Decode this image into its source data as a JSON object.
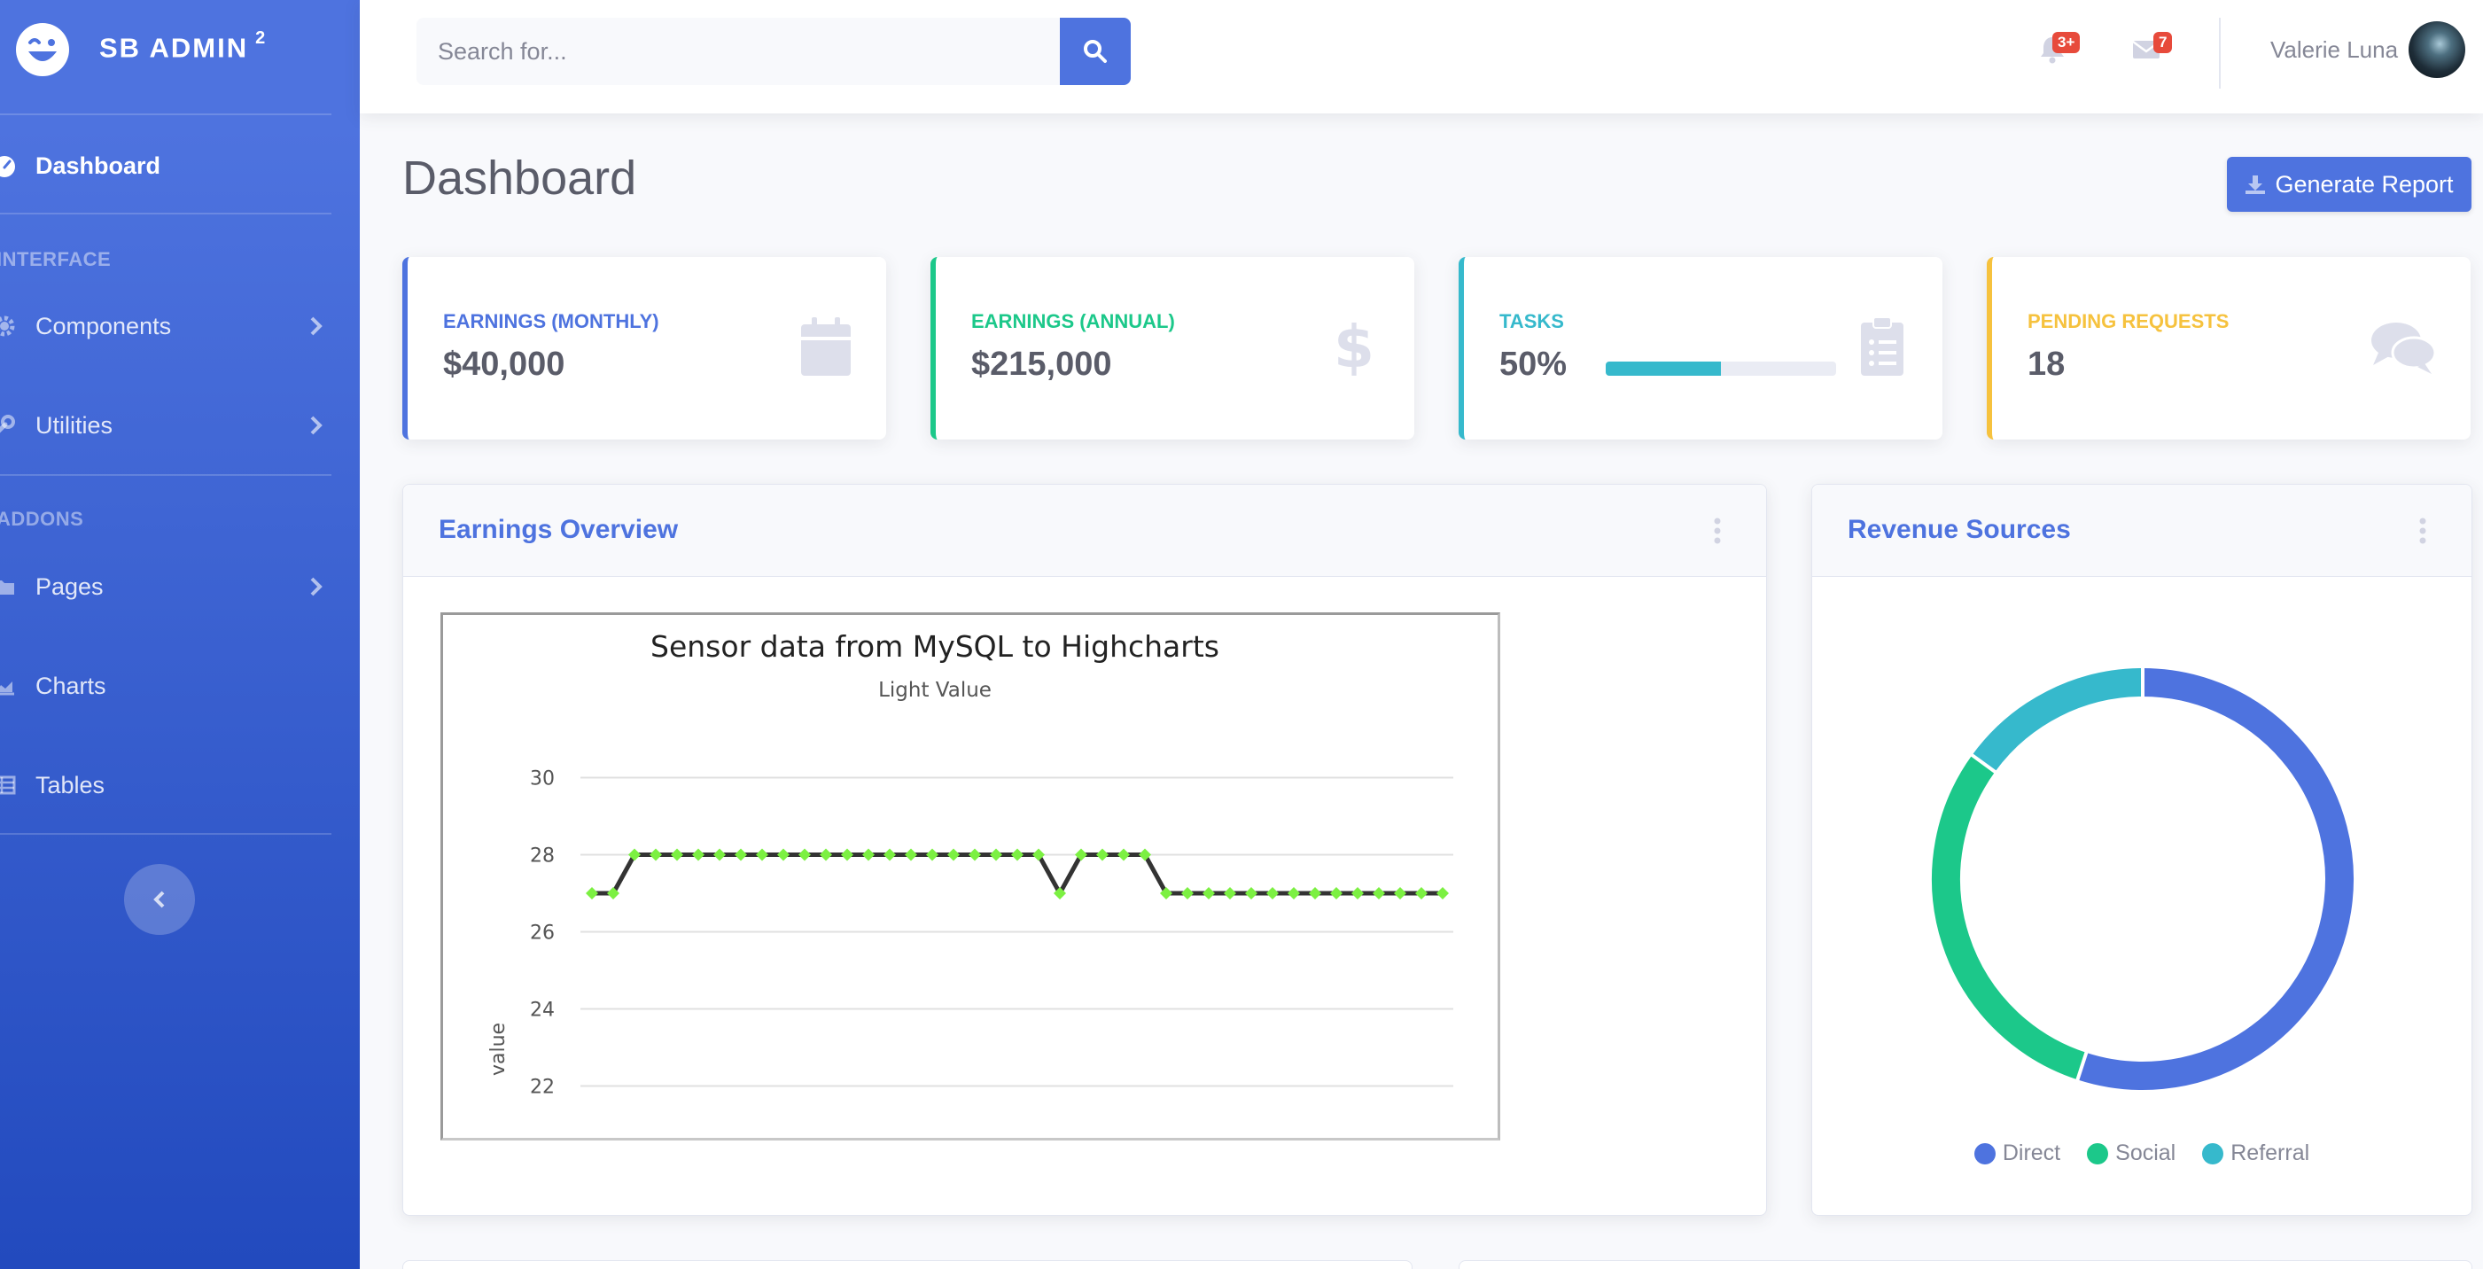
{
  "sidebar": {
    "brand": {
      "name": "SB ADMIN",
      "sup": "2",
      "logo_icon": "laugh-wink-icon"
    },
    "dashboard_label": "Dashboard",
    "section_interface": "INTERFACE",
    "section_addons": "ADDONS",
    "items": [
      {
        "label": "Components",
        "icon": "cog-icon",
        "has_chevron": true
      },
      {
        "label": "Utilities",
        "icon": "wrench-icon",
        "has_chevron": true
      },
      {
        "label": "Pages",
        "icon": "folder-icon",
        "has_chevron": true
      },
      {
        "label": "Charts",
        "icon": "chart-area-icon",
        "has_chevron": false
      },
      {
        "label": "Tables",
        "icon": "table-icon",
        "has_chevron": false
      }
    ],
    "toggler_icon": "angle-left-icon"
  },
  "topbar": {
    "search_placeholder": "Search for...",
    "alerts_badge": "3+",
    "messages_badge": "7",
    "user_name": "Valerie Luna"
  },
  "page": {
    "title": "Dashboard",
    "generate_report": "Generate Report"
  },
  "cards": [
    {
      "label": "Earnings (Monthly)",
      "value": "$40,000",
      "color": "#4e73df",
      "icon": "calendar-icon"
    },
    {
      "label": "Earnings (Annual)",
      "value": "$215,000",
      "color": "#1cc88a",
      "icon": "dollar-sign-icon"
    },
    {
      "label": "Tasks",
      "value": "50%",
      "progress": 0.5,
      "color": "#36b9cc",
      "icon": "clipboard-list-icon"
    },
    {
      "label": "Pending Requests",
      "value": "18",
      "color": "#f6c23e",
      "icon": "comments-icon"
    }
  ],
  "earnings_panel": {
    "title": "Earnings Overview"
  },
  "revenue_panel": {
    "title": "Revenue Sources"
  },
  "chart_data": [
    {
      "type": "line",
      "title": "Sensor data from MySQL to Highcharts",
      "subtitle": "Light Value",
      "ylabel": "value",
      "xlabel": "",
      "ylim": [
        21,
        31
      ],
      "yticks": [
        22,
        24,
        26,
        28,
        30
      ],
      "grid": true,
      "series": [
        {
          "values": [
            27,
            27,
            28,
            28,
            28,
            28,
            28,
            28,
            28,
            28,
            28,
            28,
            28,
            28,
            28,
            28,
            28,
            28,
            28,
            28,
            28,
            28,
            27,
            28,
            28,
            28,
            28,
            27,
            27,
            27,
            27,
            27,
            27,
            27,
            27,
            27,
            27,
            27,
            27,
            27,
            27
          ],
          "line_color": "#333333",
          "marker_color": "#7cf042"
        }
      ]
    },
    {
      "type": "pie",
      "style": "doughnut",
      "categories": [
        "Direct",
        "Social",
        "Referral"
      ],
      "values": [
        55,
        30,
        15
      ],
      "colors": [
        "#4e73df",
        "#1cc88a",
        "#36b9cc"
      ],
      "legend": "bottom"
    }
  ]
}
